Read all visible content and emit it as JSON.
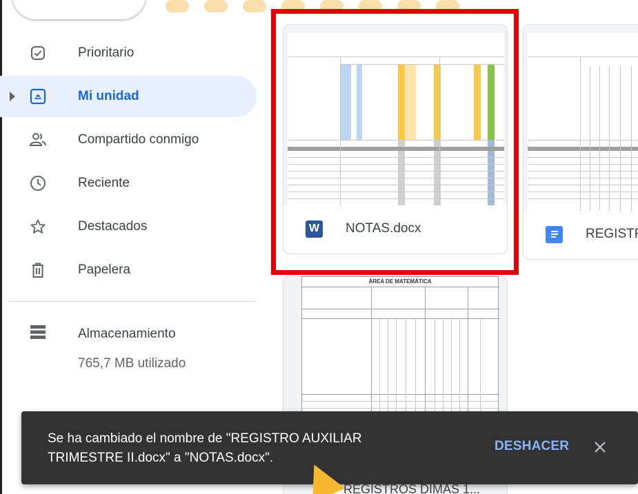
{
  "sidebar": {
    "items": [
      {
        "label": "Prioritario",
        "icon": "checkbox-check-icon"
      },
      {
        "label": "Mi unidad",
        "icon": "drive-icon",
        "active": true
      },
      {
        "label": "Compartido conmigo",
        "icon": "shared-people-icon"
      },
      {
        "label": "Reciente",
        "icon": "clock-icon"
      },
      {
        "label": "Destacados",
        "icon": "star-icon"
      },
      {
        "label": "Papelera",
        "icon": "trash-icon"
      }
    ],
    "storage": {
      "label": "Almacenamiento",
      "used": "765,7 MB utilizado",
      "icon": "storage-icon"
    }
  },
  "files": [
    {
      "name": "NOTAS.docx",
      "type": "word",
      "icon_letter": "W",
      "icon_color": "#2b579a",
      "highlighted": true
    },
    {
      "name": "REGISTR",
      "type": "google-doc",
      "icon_color": "#4285f4"
    },
    {
      "name": "REGISTROS DIMAS 1...",
      "type": "document"
    }
  ],
  "thumbnail_text": {
    "math_area_title": "ÁREA DE MATEMÁTICA"
  },
  "snackbar": {
    "message": "Se ha cambiado el nombre de \"REGISTRO AUXILIAR TRIMESTRE II.docx\" a \"NOTAS.docx\".",
    "action": "DESHACER",
    "close_icon": "close-icon"
  },
  "colors": {
    "accent": "#1967d2",
    "active_bg": "#e8f0fe",
    "highlight": "#e30000",
    "snackbar_bg": "#323232",
    "snackbar_action": "#8ab4f8",
    "sheet_yellow": "#f7c948",
    "sheet_green": "#8bc34a",
    "sheet_blue": "#bcd6f2"
  }
}
